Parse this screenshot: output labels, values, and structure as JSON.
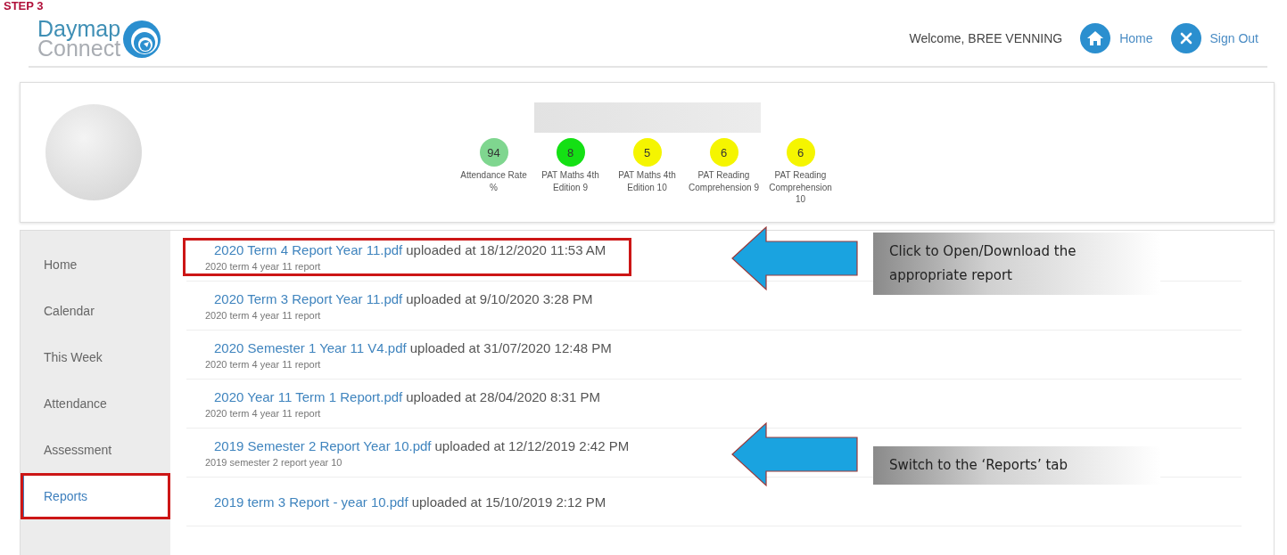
{
  "step_label": "STEP 3",
  "header": {
    "logo_top": "Daymap",
    "logo_bottom": "Connect",
    "welcome": "Welcome, BREE VENNING",
    "links": [
      {
        "label": "Home",
        "kind": "home"
      },
      {
        "label": "Sign Out",
        "kind": "signout"
      }
    ]
  },
  "profile": {
    "stats": [
      {
        "value": "94",
        "label": "Attendance Rate %",
        "color": "#7fd68f"
      },
      {
        "value": "8",
        "label": "PAT Maths 4th Edition 9",
        "color": "#14e014"
      },
      {
        "value": "5",
        "label": "PAT Maths 4th Edition 10",
        "color": "#f5f500"
      },
      {
        "value": "6",
        "label": "PAT Reading Comprehension 9",
        "color": "#f5f500"
      },
      {
        "value": "6",
        "label": "PAT Reading Comprehension 10",
        "color": "#f5f500"
      }
    ]
  },
  "sidebar": {
    "items": [
      {
        "label": "Home",
        "selected": false,
        "highlighted": false
      },
      {
        "label": "Calendar",
        "selected": false,
        "highlighted": false
      },
      {
        "label": "This Week",
        "selected": false,
        "highlighted": false
      },
      {
        "label": "Attendance",
        "selected": false,
        "highlighted": false
      },
      {
        "label": "Assessment",
        "selected": false,
        "highlighted": false
      },
      {
        "label": "Reports",
        "selected": true,
        "highlighted": true
      }
    ]
  },
  "reports": [
    {
      "file": "2020 Term 4 Report Year 11.pdf",
      "uploaded": "uploaded at 18/12/2020 11:53 AM",
      "description": "2020 term 4 year 11 report",
      "highlighted": true,
      "callout": "Click to Open/Download the appropriate report"
    },
    {
      "file": "2020 Term 3 Report Year 11.pdf",
      "uploaded": "uploaded at 9/10/2020 3:28 PM",
      "description": "2020 term 4 year 11 report",
      "highlighted": false
    },
    {
      "file": "2020 Semester 1 Year 11 V4.pdf",
      "uploaded": "uploaded at 31/07/2020 12:48 PM",
      "description": "2020 term 4 year 11 report",
      "highlighted": false
    },
    {
      "file": "2020 Year 11 Term 1 Report.pdf",
      "uploaded": "uploaded at 28/04/2020 8:31 PM",
      "description": "2020 term 4 year 11 report",
      "highlighted": false
    },
    {
      "file": "2019 Semester 2 Report Year 10.pdf",
      "uploaded": "uploaded at 12/12/2019 2:42 PM",
      "description": "2019 semester 2 report year 10",
      "highlighted": false,
      "callout": "Switch to the ‘Reports’ tab"
    },
    {
      "file": "2019 term 3 Report - year 10.pdf",
      "uploaded": "uploaded at 15/10/2019 2:12 PM",
      "highlighted": false
    }
  ]
}
